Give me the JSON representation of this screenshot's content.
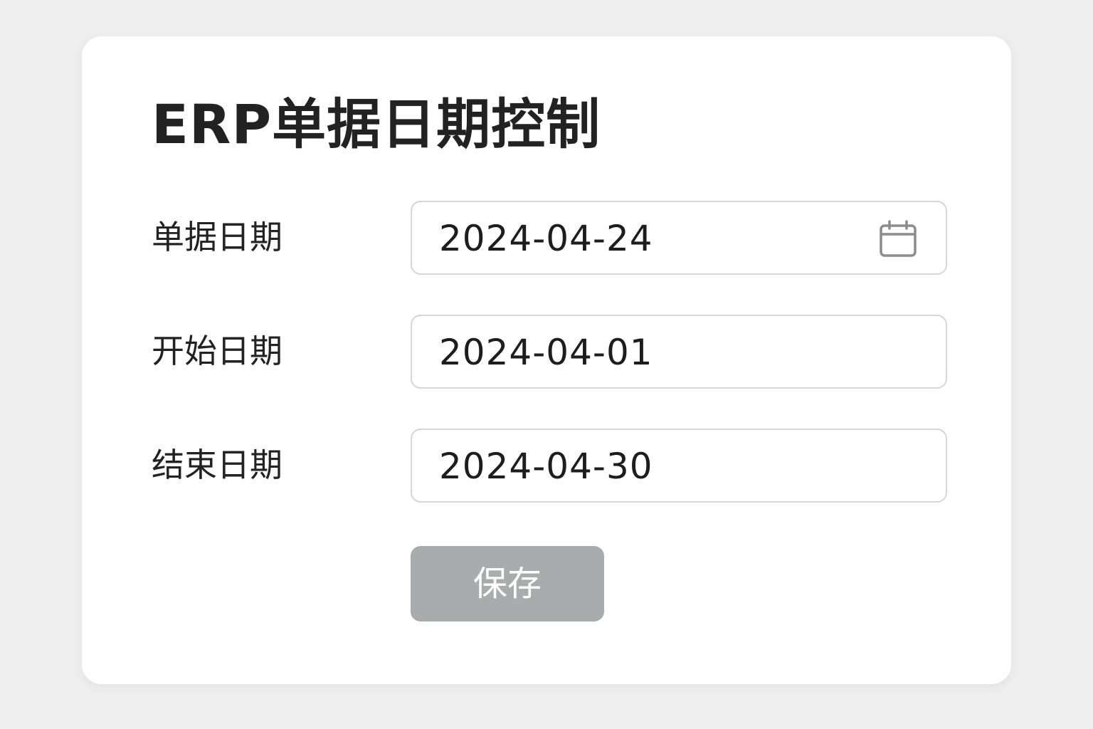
{
  "page": {
    "title": "ERP单据日期控制"
  },
  "form": {
    "fields": [
      {
        "label": "单据日期",
        "value": "2024-04-24",
        "icon": "calendar-icon"
      },
      {
        "label": "开始日期",
        "value": "2024-04-01"
      },
      {
        "label": "结束日期",
        "value": "2024-04-30"
      }
    ],
    "save_label": "保存"
  },
  "colors": {
    "background": "#efefef",
    "card": "#ffffff",
    "button_disabled": "#a9acad",
    "field_border": "#d6d6d6"
  }
}
